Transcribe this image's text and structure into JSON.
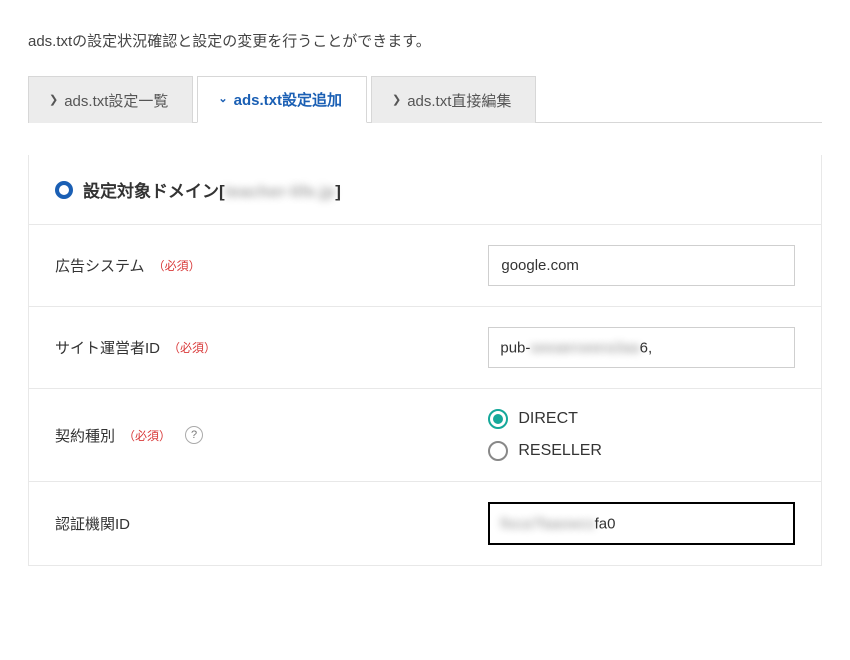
{
  "description": "ads.txtの設定状況確認と設定の変更を行うことができます。",
  "tabs": {
    "list": "ads.txt設定一覧",
    "add": "ads.txt設定追加",
    "edit": "ads.txt直接編集",
    "active": "add"
  },
  "section": {
    "title_prefix": "設定対象ドメイン[",
    "domain_masked": "teacher-life.jp",
    "title_suffix": "]"
  },
  "labels": {
    "required": "（必須）",
    "help": "?"
  },
  "fields": {
    "ad_system": {
      "label": "広告システム",
      "required": true,
      "value": "google.com"
    },
    "publisher_id": {
      "label": "サイト運営者ID",
      "required": true,
      "value_prefix": "pub-",
      "value_masked": "seeaeroeera3aa",
      "value_suffix": "6,"
    },
    "contract_type": {
      "label": "契約種別",
      "required": true,
      "help": true,
      "options": {
        "direct": "DIRECT",
        "reseller": "RESELLER"
      },
      "selected": "direct"
    },
    "cert_authority_id": {
      "label": "認証機関ID",
      "required": false,
      "value_masked": "fisca7faaowcs",
      "value_suffix": "fa0"
    }
  }
}
